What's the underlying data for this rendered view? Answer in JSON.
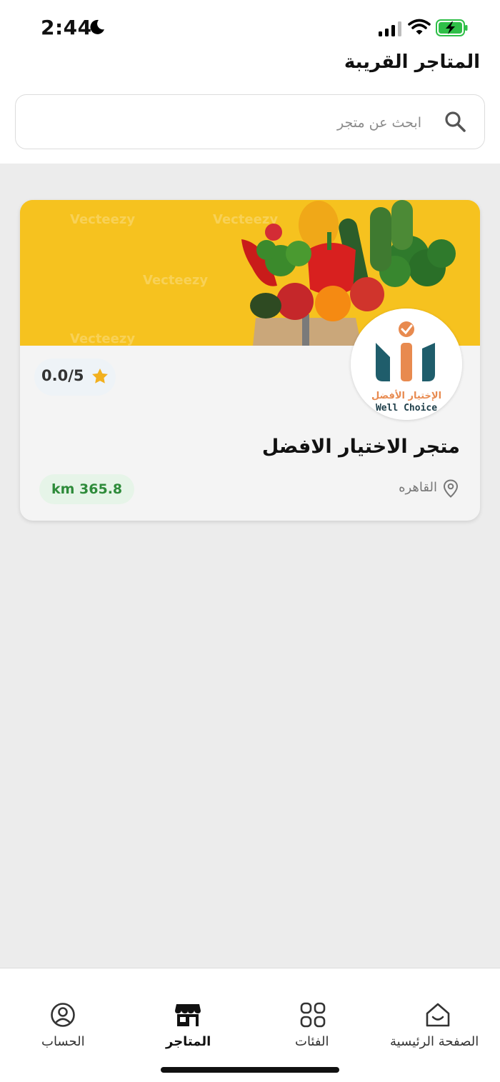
{
  "status_bar": {
    "time": "2:44",
    "icons": [
      "moon-icon",
      "signal-icon",
      "wifi-icon",
      "battery-charging-icon"
    ]
  },
  "header": {
    "title": "المتاجر القريبة"
  },
  "search": {
    "placeholder": "ابحث عن متجر",
    "icon": "search-icon"
  },
  "stores": [
    {
      "name": "متجر الاختيار الافضل",
      "rating": "0.0/5",
      "city": "القاهره",
      "distance": "km 365.8",
      "logo": {
        "text_ar": "الإختيار الأفضل",
        "text_en": "Well Choice"
      },
      "cover_watermark": "Vecteezy"
    }
  ],
  "bottom_nav": {
    "items": [
      {
        "label": "الحساب",
        "icon": "account-icon"
      },
      {
        "label": "المتاجر",
        "icon": "store-icon",
        "active": true
      },
      {
        "label": "الفئات",
        "icon": "categories-icon"
      },
      {
        "label": "الصفحة الرئيسية",
        "icon": "home-icon"
      }
    ]
  },
  "colors": {
    "accent_green": "#2e8b3a",
    "star_yellow": "#f2b01e",
    "cover_yellow": "#f6c21f",
    "logo_teal": "#1f5d6b",
    "logo_orange": "#e88a4f"
  }
}
